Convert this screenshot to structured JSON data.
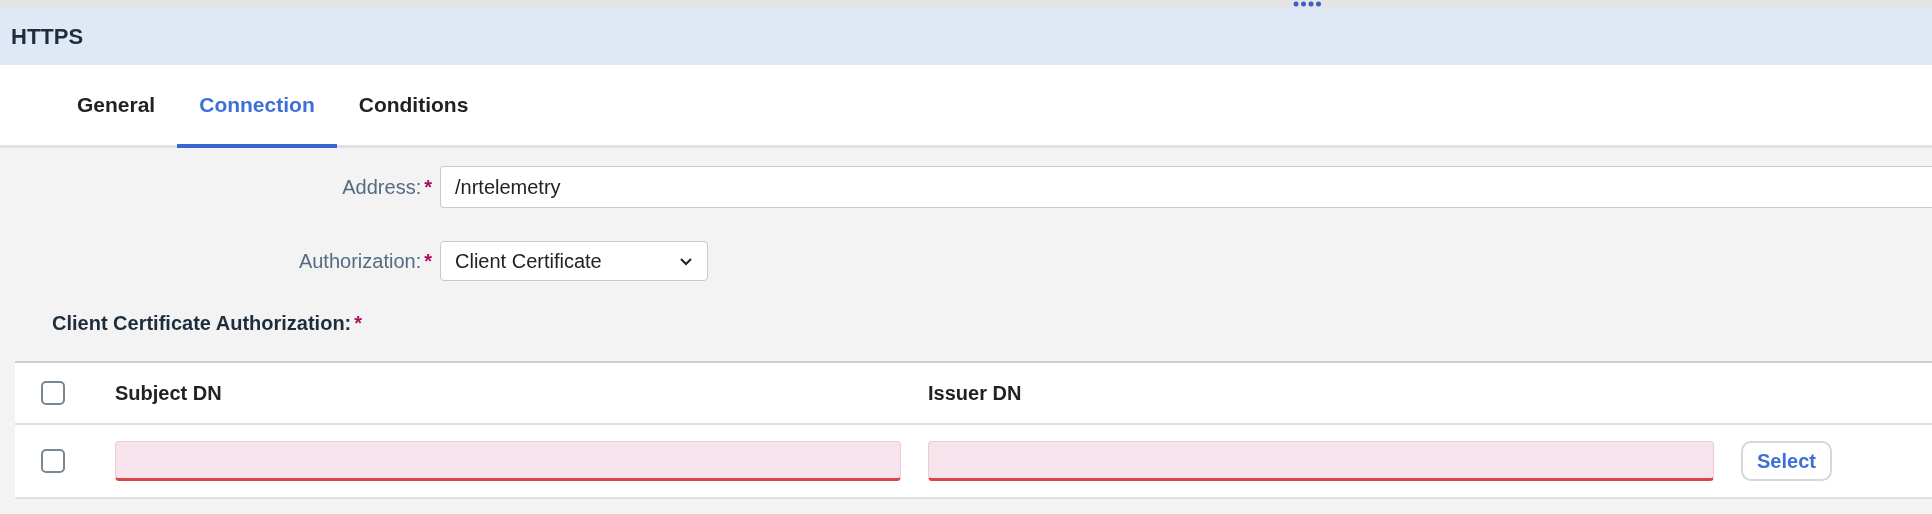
{
  "panel": {
    "title": "HTTPS"
  },
  "tabs": [
    {
      "label": "General",
      "selected": false
    },
    {
      "label": "Connection",
      "selected": true
    },
    {
      "label": "Conditions",
      "selected": false
    }
  ],
  "form": [
    {
      "kind": "input",
      "label": "Address:",
      "required_mark": "*",
      "value": "/nrtelemetry"
    },
    {
      "kind": "select",
      "label": "Authorization:",
      "required_mark": "*",
      "value": "Client Certificate"
    }
  ],
  "section": {
    "label": "Client Certificate Authorization:",
    "required_mark": "*"
  },
  "table": {
    "select_all": {
      "checked": false
    },
    "columns": [
      "Subject DN",
      "Issuer DN"
    ],
    "rows": [
      {
        "checked": false,
        "cells": [
          {
            "invalid": true
          },
          {
            "invalid": true
          }
        ],
        "action": "Select"
      }
    ]
  }
}
